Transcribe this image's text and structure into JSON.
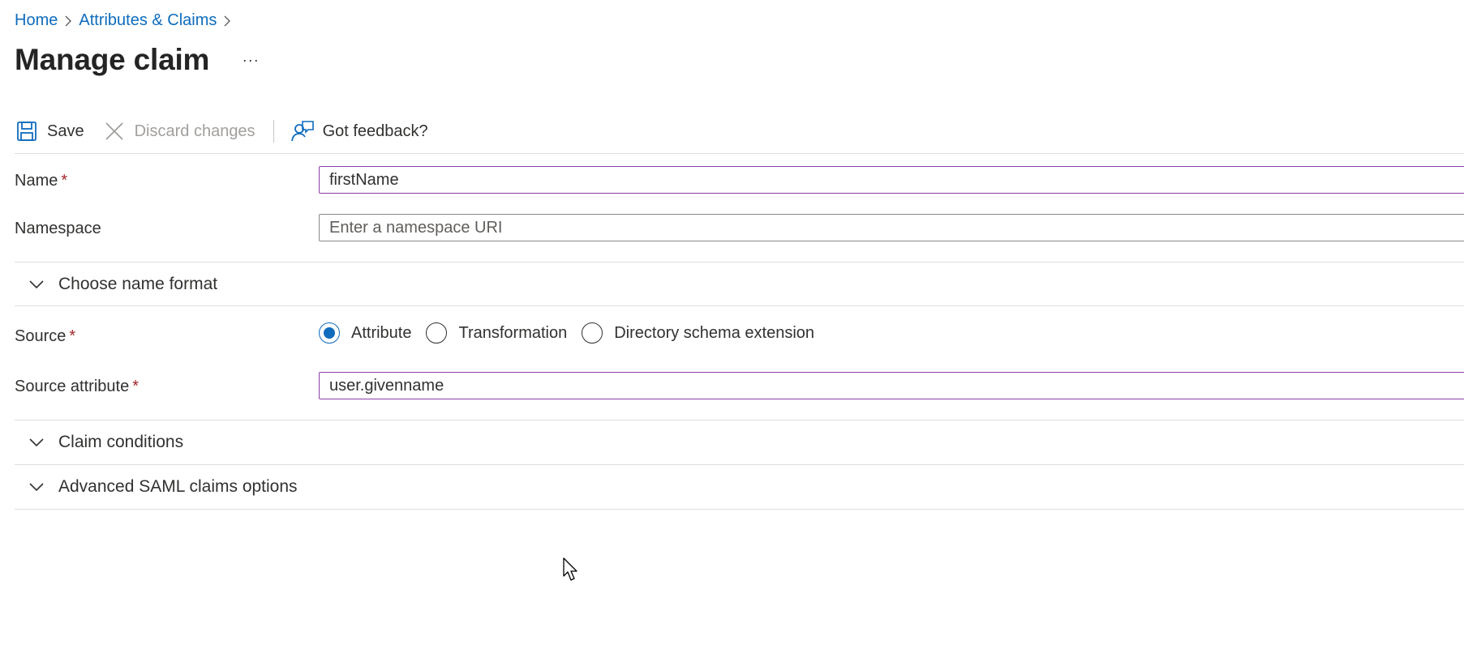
{
  "breadcrumb": {
    "items": [
      "Home",
      "Attributes & Claims"
    ]
  },
  "header": {
    "title": "Manage claim",
    "more_label": "···"
  },
  "toolbar": {
    "save_label": "Save",
    "discard_label": "Discard changes",
    "feedback_label": "Got feedback?"
  },
  "form": {
    "name": {
      "label": "Name",
      "required_mark": "*",
      "value": "firstName"
    },
    "namespace": {
      "label": "Namespace",
      "value": "",
      "placeholder": "Enter a namespace URI"
    },
    "name_format_section": "Choose name format",
    "source": {
      "label": "Source",
      "required_mark": "*",
      "options": [
        "Attribute",
        "Transformation",
        "Directory schema extension"
      ],
      "selected": "Attribute"
    },
    "source_attribute": {
      "label": "Source attribute",
      "required_mark": "*",
      "value": "user.givenname"
    },
    "claim_conditions_section": "Claim conditions",
    "advanced_section": "Advanced SAML claims options"
  },
  "colors": {
    "link": "#0f6cbd",
    "accent": "#0f6cbd",
    "required": "#a4262c",
    "focus_border": "#8a3ea8",
    "disabled_text": "#a19f9d"
  },
  "icons": {
    "save": "save-icon",
    "discard": "close-icon",
    "feedback": "feedback-icon",
    "chevron": "chevron-down-icon",
    "breadcrumb_sep": "chevron-right-icon"
  }
}
